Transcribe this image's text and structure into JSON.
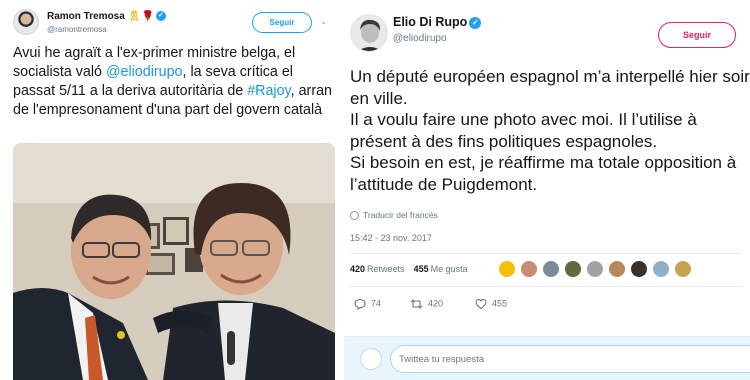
{
  "left_tweet": {
    "author_name": "Ramon Tremosa",
    "author_handle": "@ramontremosa",
    "follow_label": "Seguir",
    "text_part1": "Avui he agraït a l'ex-primer ministre belga, el socialista való ",
    "mention": "@eliodirupo",
    "text_part2": ", la seva crítica el passat 5/11 a la deriva autoritària de ",
    "hashtag": "#Rajoy",
    "text_part3": ", arran de l'empresonament d'una part del govern català"
  },
  "right_tweet": {
    "author_name": "Elio Di Rupo",
    "author_handle": "@eliodirupo",
    "follow_label": "Seguir",
    "text": "Un député européen espagnol m’a interpellé hier soir en ville.\nIl a voulu faire une photo avec moi. Il l’utilise à présent à des fins politiques espagnoles.\nSi besoin en est, je réaffirme ma totale opposition à l’attitude de Puigdemont.",
    "translate_label": "Traducir del francés",
    "timestamp": "15:42 - 23 nov. 2017",
    "retweets_count": "420",
    "retweets_label": "Retweets",
    "likes_count": "455",
    "likes_label": "Me gusta",
    "reply_count": "74",
    "retweet_action_count": "420",
    "like_action_count": "455",
    "reply_placeholder": "Twittea tu respuesta"
  },
  "colors": {
    "link": "#1b95e0",
    "verified": "#1da1f2",
    "follow_left": "#1da1f2",
    "follow_right": "#e0245e",
    "secondary_text": "#657786"
  },
  "icons": [
    "verified-icon",
    "ribbon-icon",
    "rose-icon",
    "chevron-down-icon",
    "globe-icon",
    "reply-icon",
    "retweet-icon",
    "heart-icon"
  ]
}
